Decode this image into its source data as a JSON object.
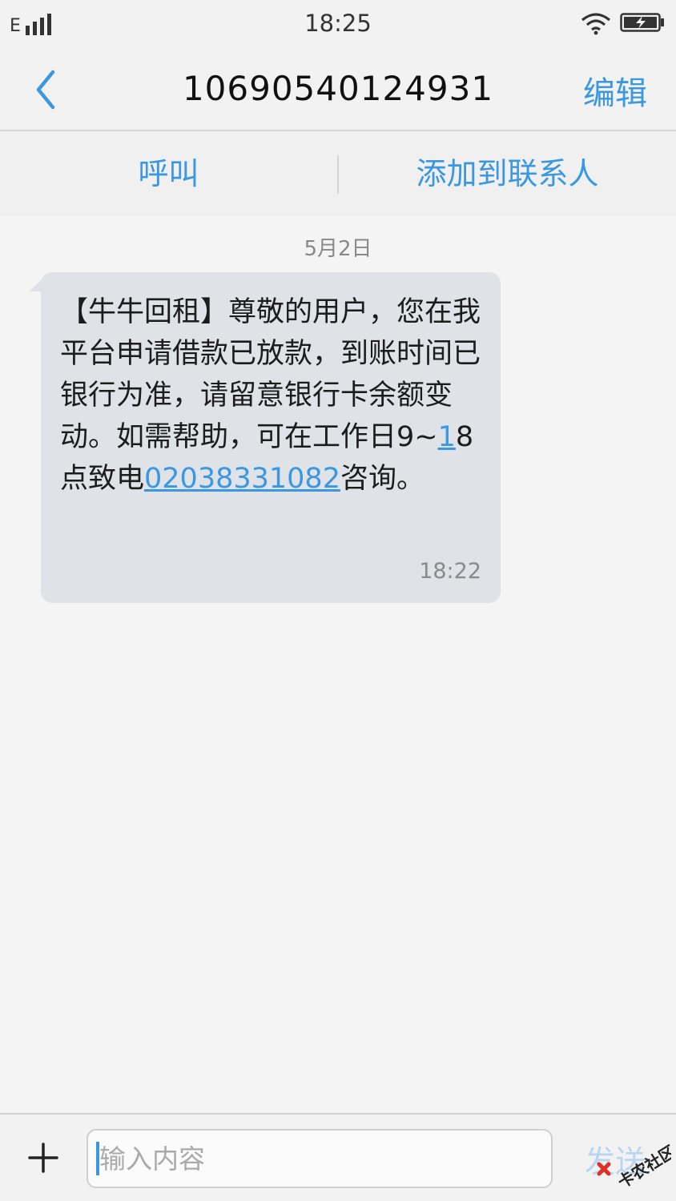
{
  "status_bar": {
    "network": "E",
    "time": "18:25",
    "icons": [
      "signal-icon",
      "wifi-icon",
      "battery-charging-icon"
    ]
  },
  "header": {
    "title": "10690540124931",
    "edit_label": "编辑",
    "back_icon": "chevron-left-icon"
  },
  "actions": {
    "call_label": "呼叫",
    "add_contact_label": "添加到联系人"
  },
  "conversation": {
    "date": "5月2日",
    "messages": [
      {
        "text_before": "【牛牛回租】尊敬的用户，您在我平台申请借款已放款，到账时间已银行为准，请留意银行卡余额变动。如需帮助，可在工作日9~",
        "link_one": "1",
        "text_middle": "8点致电",
        "link_two": "02038331082",
        "text_after": "咨询。",
        "time": "18:22"
      }
    ]
  },
  "composer": {
    "placeholder": "输入内容",
    "value": "",
    "send_label": "发送",
    "add_icon": "plus-icon"
  },
  "watermark": {
    "text": "卡农社区"
  },
  "colors": {
    "accent": "#3a97e0",
    "bubble": "#dfe2e6",
    "background": "#f4f4f4",
    "send_disabled": "#b9d6f0"
  }
}
